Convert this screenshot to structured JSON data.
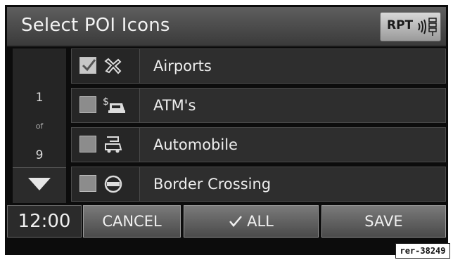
{
  "header": {
    "title": "Select POI Icons",
    "rpt_label": "RPT"
  },
  "pagination": {
    "current": "1",
    "of_label": "of",
    "total": "9"
  },
  "poi_items": [
    {
      "label": "Airports",
      "checked": true,
      "icon": "airplane-icon"
    },
    {
      "label": "ATM's",
      "checked": false,
      "icon": "atm-icon"
    },
    {
      "label": "Automobile",
      "checked": false,
      "icon": "automobile-icon"
    },
    {
      "label": "Border Crossing",
      "checked": false,
      "icon": "border-crossing-icon"
    }
  ],
  "footer": {
    "time": "12:00",
    "cancel_label": "CANCEL",
    "all_label": "ALL",
    "save_label": "SAVE"
  },
  "reference_tag": "rer-38249",
  "colors": {
    "screen_bg": "#0c0c0c",
    "header_bg": "#4a4a4a",
    "row_bg": "#2e2e2e",
    "text": "#eeeeee"
  }
}
